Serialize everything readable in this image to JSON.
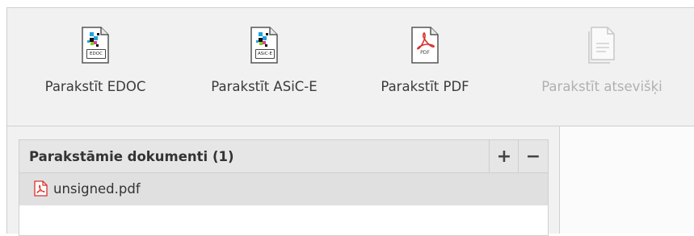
{
  "toolbar": {
    "buttons": [
      {
        "label": "Parakstīt EDOC",
        "icon_tag": "EDOC",
        "icon": "edoc-file-icon",
        "enabled": true
      },
      {
        "label": "Parakstīt ASiC-E",
        "icon_tag": "ASiC-E",
        "icon": "asice-file-icon",
        "enabled": true
      },
      {
        "label": "Parakstīt PDF",
        "icon_tag": "PDF",
        "icon": "pdf-file-icon",
        "enabled": true
      },
      {
        "label": "Parakstīt atsevišķi",
        "icon": "document-icon",
        "enabled": false
      }
    ]
  },
  "documents_panel": {
    "title": "Parakstāmie dokumenti (1)",
    "add_label": "+",
    "remove_label": "−",
    "items": [
      {
        "name": "unsigned.pdf",
        "icon": "pdf-small-icon"
      }
    ]
  },
  "colors": {
    "pdf_red": "#d9302c",
    "toolbar_bg": "#f1f1f1",
    "selected_row": "#e0e0e0"
  }
}
